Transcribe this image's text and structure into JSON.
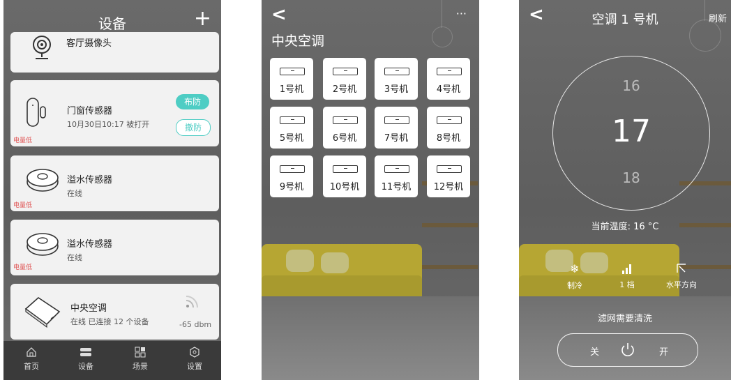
{
  "screen1": {
    "title": "设备",
    "add_label": "+",
    "devices": [
      {
        "name": "客厅摄像头",
        "icon": "camera-icon"
      },
      {
        "name": "门窗传感器",
        "status": "10月30日10:17 被打开",
        "low_battery": "电量低",
        "arm_label": "布防",
        "disarm_label": "撤防",
        "icon": "door-sensor-icon"
      },
      {
        "name": "溢水传感器",
        "status": "在线",
        "low_battery": "电量低",
        "icon": "water-sensor-icon"
      },
      {
        "name": "溢水传感器",
        "status": "在线",
        "low_battery": "电量低",
        "icon": "water-sensor-icon"
      },
      {
        "name": "中央空调",
        "status": "在线 已连接 12 个设备",
        "signal": "-65 dbm",
        "icon": "gateway-icon"
      }
    ],
    "tabs": [
      {
        "label": "首页",
        "icon": "home-icon"
      },
      {
        "label": "设备",
        "icon": "devices-icon"
      },
      {
        "label": "场景",
        "icon": "scenes-icon"
      },
      {
        "label": "设置",
        "icon": "settings-icon"
      }
    ],
    "accent": "#4ecdc4"
  },
  "screen2": {
    "back_label": "<",
    "more_label": "···",
    "title": "中央空调",
    "units": [
      "1号机",
      "2号机",
      "3号机",
      "4号机",
      "5号机",
      "6号机",
      "7号机",
      "8号机",
      "9号机",
      "10号机",
      "11号机",
      "12号机"
    ]
  },
  "screen3": {
    "back_label": "<",
    "title": "空调 1 号机",
    "refresh_label": "刷新",
    "temp_prev": "16",
    "temp_current": "17",
    "temp_next": "18",
    "current_temp": "当前温度: 16 °C",
    "modes": [
      {
        "label": "制冷",
        "icon": "snowflake-icon"
      },
      {
        "label": "1 档",
        "icon": "fan-speed-icon"
      },
      {
        "label": "水平方向",
        "icon": "swing-direction-icon"
      }
    ],
    "filter_notice": "滤网需要清洗",
    "off_label": "关",
    "on_label": "开"
  }
}
